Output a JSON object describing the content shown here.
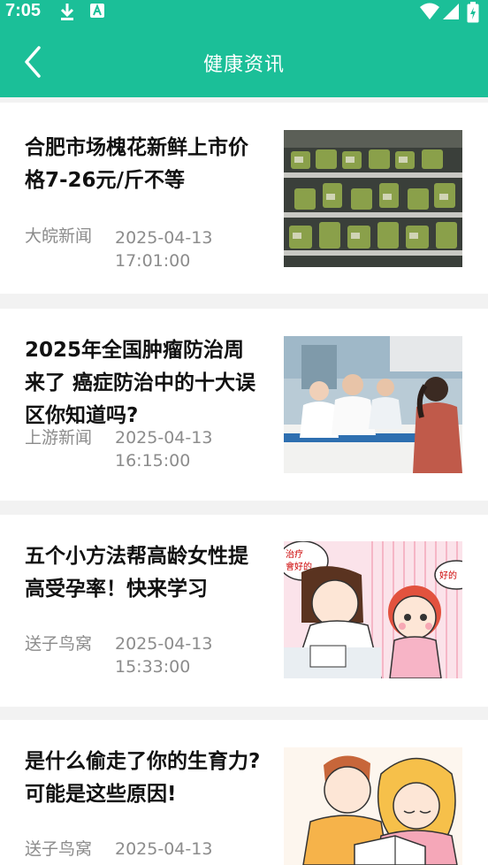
{
  "status_bar": {
    "time": "7:05",
    "icons": [
      "download-icon",
      "a-icon",
      "wifi-icon",
      "signal-icon",
      "battery-icon"
    ]
  },
  "header": {
    "title": "健康资讯",
    "back_icon": "back-arrow-icon",
    "background": "#1bbf98"
  },
  "articles": [
    {
      "title": "合肥市场槐花新鲜上市价格7-26元/斤不等",
      "source": "大皖新闻",
      "datetime": "2025-04-13 17:01:00",
      "thumbnail": "market-shelf-photo"
    },
    {
      "title": "2025年全国肿瘤防治周来了 癌症防治中的十大误区你知道吗?",
      "source": "上游新闻",
      "datetime": "2025-04-13 16:15:00",
      "thumbnail": "doctors-consultation-photo"
    },
    {
      "title": "五个小方法帮高龄女性提高受孕率！快来学习",
      "source": "送子鸟窝",
      "datetime": "2025-04-13 15:33:00",
      "thumbnail": "cartoon-doctor-patient-illustration",
      "thumb_texts": [
        "治疗",
        "會好的",
        "好的"
      ]
    },
    {
      "title": "是什么偷走了你的生育力?可能是这些原因!",
      "source": "送子鸟窝",
      "datetime": "2025-04-13",
      "thumbnail": "cartoon-couple-illustration"
    }
  ]
}
